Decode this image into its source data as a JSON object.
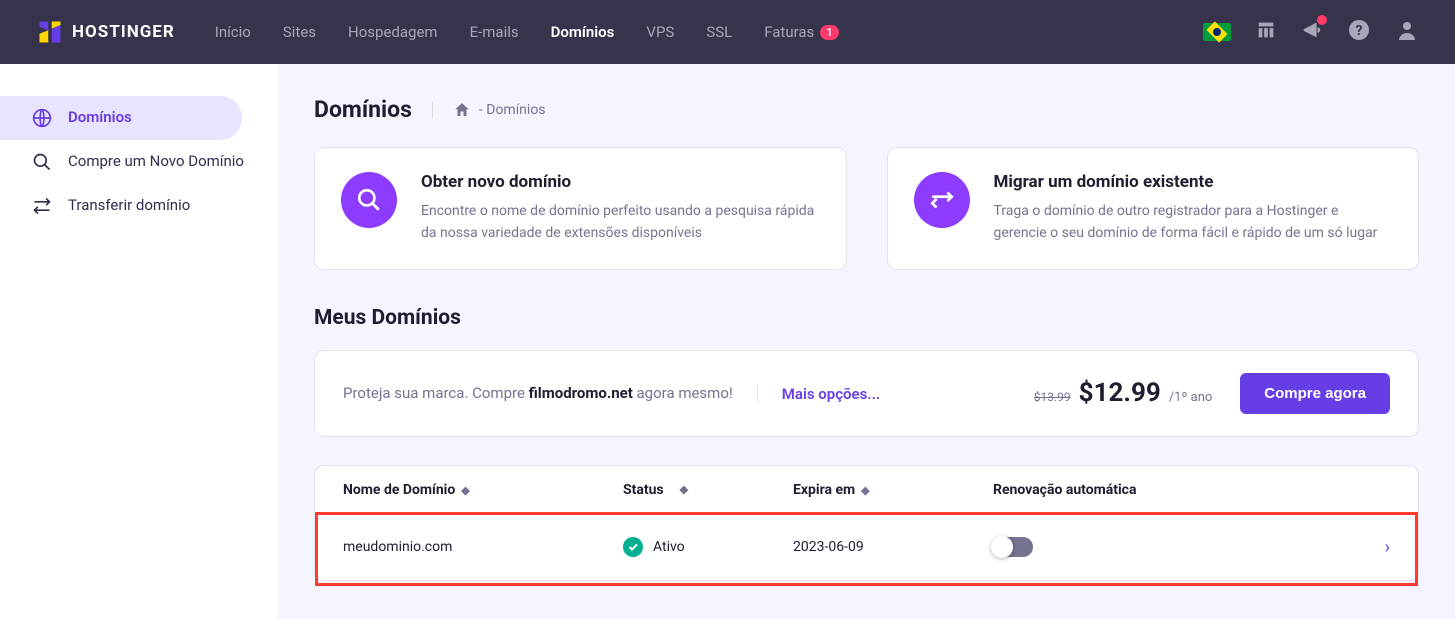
{
  "brand": "HOSTINGER",
  "nav": {
    "items": [
      {
        "label": "Início"
      },
      {
        "label": "Sites"
      },
      {
        "label": "Hospedagem"
      },
      {
        "label": "E-mails"
      },
      {
        "label": "Domínios",
        "active": true
      },
      {
        "label": "VPS"
      },
      {
        "label": "SSL"
      },
      {
        "label": "Faturas",
        "badge": "1"
      }
    ]
  },
  "sidebar": {
    "items": [
      {
        "label": "Domínios",
        "active": true
      },
      {
        "label": "Compre um Novo Domínio"
      },
      {
        "label": "Transferir domínio"
      }
    ]
  },
  "page": {
    "title": "Domínios",
    "breadcrumb": "- Domínios"
  },
  "cards": [
    {
      "title": "Obter novo domínio",
      "desc": "Encontre o nome de domínio perfeito usando a pesquisa rápida da nossa variedade de extensões disponíveis",
      "icon": "search"
    },
    {
      "title": "Migrar um domínio existente",
      "desc": "Traga o domínio de outro registrador para a Hostinger e gerencie o seu domínio de forma fácil e rápido de um só lugar",
      "icon": "transfer"
    }
  ],
  "section_title": "Meus Domínios",
  "promo": {
    "text_prefix": "Proteja sua marca. Compre ",
    "domain": "filmodromo.net",
    "text_suffix": " agora mesmo!",
    "more": "Mais opções...",
    "old_price": "$13.99",
    "new_price": "$12.99",
    "period": "/1º ano",
    "buy": "Compre agora"
  },
  "table": {
    "headers": {
      "name": "Nome de Domínio",
      "status": "Status",
      "expires": "Expira em",
      "renew": "Renovação automática"
    },
    "rows": [
      {
        "name": "meudominio.com",
        "status": "Ativo",
        "expires": "2023-06-09",
        "renew": false
      }
    ]
  }
}
